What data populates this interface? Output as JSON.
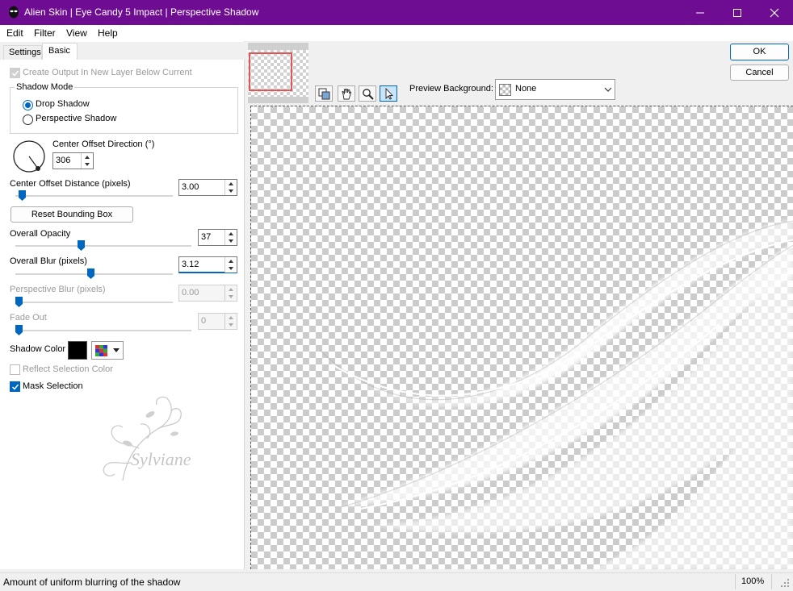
{
  "window": {
    "title": "Alien Skin | Eye Candy 5 Impact | Perspective Shadow",
    "titlebar_color": "#6e0c92"
  },
  "menu": [
    "Edit",
    "Filter",
    "View",
    "Help"
  ],
  "tabs": [
    "Settings",
    "Basic"
  ],
  "active_tab": "Basic",
  "controls": {
    "create_output_label": "Create Output In New Layer Below Current",
    "create_output_checked": true,
    "shadow_mode_label": "Shadow Mode",
    "shadow_mode_options": [
      "Drop Shadow",
      "Perspective Shadow"
    ],
    "shadow_mode_selected": "Drop Shadow",
    "direction_label": "Center Offset Direction (°)",
    "direction_value": "306",
    "offset_distance_label": "Center Offset Distance (pixels)",
    "offset_distance_value": "3.00",
    "offset_distance_fraction": 0.02,
    "reset_bbox_label": "Reset Bounding Box",
    "opacity_label": "Overall Opacity",
    "opacity_value": "37",
    "opacity_fraction": 0.37,
    "blur_label": "Overall Blur (pixels)",
    "blur_value": "3.12",
    "blur_fraction": 0.48,
    "perspective_blur_label": "Perspective Blur (pixels)",
    "perspective_blur_value": "0.00",
    "fade_out_label": "Fade Out",
    "fade_out_value": "0",
    "shadow_color_label": "Shadow Color",
    "shadow_color": "#000000",
    "reflect_label": "Reflect Selection Color",
    "reflect_checked": false,
    "mask_label": "Mask Selection",
    "mask_checked": true
  },
  "watermark_text": "Sylviane",
  "buttons": {
    "ok": "OK",
    "cancel": "Cancel"
  },
  "preview": {
    "background_label": "Preview Background:",
    "background_value": "None"
  },
  "status": {
    "message": "Amount of uniform blurring of the shadow",
    "zoom": "100%"
  },
  "accent_color": "#0067c0"
}
